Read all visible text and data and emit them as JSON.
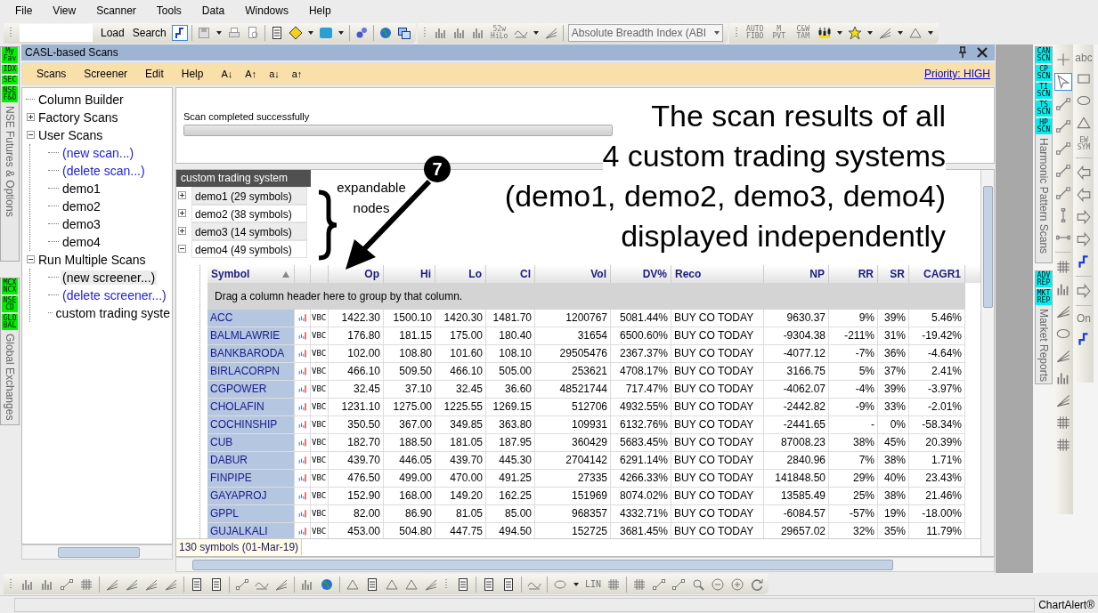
{
  "menu": [
    "File",
    "View",
    "Scanner",
    "Tools",
    "Data",
    "Windows",
    "Help"
  ],
  "toolbar": {
    "buttons": [
      "Load",
      "Search"
    ],
    "chart_labels": [
      "52w HiLo"
    ],
    "indicator_combo": "Absolute Breadth Index (ABI",
    "tool_labels": [
      "AUTO FIBO",
      "M PVT",
      "C&W TAM"
    ]
  },
  "left_tabs": [
    {
      "badges": [
        "My Fav",
        "IDX",
        "SEC",
        "NSE F&O"
      ],
      "label": "NSE Futures & Options"
    },
    {
      "badges": [
        "MCX NCX",
        "NSE CD",
        "GLOBAL"
      ],
      "label": "Global Exchanges"
    }
  ],
  "panel": {
    "title": "CASL-based Scans",
    "menu": [
      "Scans",
      "Screener",
      "Edit",
      "Help"
    ],
    "sort_buttons": [
      "A↓",
      "A↑",
      "a↓",
      "a↑"
    ],
    "priority_link": "Priority: HIGH"
  },
  "tree": [
    {
      "label": "Column Builder",
      "kind": "item",
      "selected": false
    },
    {
      "label": "Factory Scans",
      "kind": "folder",
      "expanded": false,
      "selected": false
    },
    {
      "label": "User Scans",
      "kind": "folder",
      "expanded": true,
      "selected": false,
      "children": [
        {
          "label": "(new scan...)",
          "kind": "action",
          "selected": false
        },
        {
          "label": "(delete scan...)",
          "kind": "action",
          "selected": false
        },
        {
          "label": "demo1",
          "kind": "item",
          "selected": false
        },
        {
          "label": "demo2",
          "kind": "item",
          "selected": false
        },
        {
          "label": "demo3",
          "kind": "item",
          "selected": false
        },
        {
          "label": "demo4",
          "kind": "item",
          "selected": false
        }
      ]
    },
    {
      "label": "Run Multiple Scans",
      "kind": "folder",
      "expanded": true,
      "selected": false,
      "children": [
        {
          "label": "(new screener...)",
          "kind": "action",
          "selected": true
        },
        {
          "label": "(delete screener...)",
          "kind": "action",
          "selected": false
        },
        {
          "label": "custom trading syste",
          "kind": "item",
          "selected": false
        }
      ]
    }
  ],
  "status": {
    "message": "Scan completed successfully",
    "level": 1
  },
  "results": {
    "title": "custom trading system",
    "groups": [
      {
        "label": "demo1 (29 symbols)",
        "expanded": false
      },
      {
        "label": "demo2 (38 symbols)",
        "expanded": false
      },
      {
        "label": "demo3 (14 symbols)",
        "expanded": false
      },
      {
        "label": "demo4 (49 symbols)",
        "expanded": true
      }
    ],
    "columns": [
      {
        "label": "Symbol",
        "kind": "symbol",
        "sorted_ascending": true
      },
      {
        "kind": "chart"
      },
      {
        "kind": "tag"
      },
      {
        "label": "Op",
        "kind": "number"
      },
      {
        "label": "Hi",
        "kind": "number"
      },
      {
        "label": "Lo",
        "kind": "number"
      },
      {
        "label": "Cl",
        "kind": "number"
      },
      {
        "label": "Vol",
        "kind": "number"
      },
      {
        "label": "DV%",
        "kind": "number"
      },
      {
        "label": "Reco",
        "kind": "text"
      },
      {
        "label": "NP",
        "kind": "number"
      },
      {
        "label": "RR",
        "kind": "number"
      },
      {
        "label": "SR",
        "kind": "number"
      },
      {
        "label": "CAGR1",
        "kind": "number"
      }
    ],
    "group_hint": "Drag a column header here to group by that column.",
    "rows": [
      {
        "cells": [
          "ACC",
          "",
          "VBC",
          "1422.30",
          "1500.10",
          "1420.30",
          "1481.70",
          "1200767",
          "5081.44%",
          "BUY CO TODAY",
          "9630.37",
          "9%",
          "39%",
          "5.46%"
        ]
      },
      {
        "cells": [
          "BALMLAWRIE",
          "",
          "VBC",
          "176.80",
          "181.15",
          "175.00",
          "180.40",
          "31654",
          "6500.60%",
          "BUY CO TODAY",
          "-9304.38",
          "-211%",
          "31%",
          "-19.42%"
        ]
      },
      {
        "cells": [
          "BANKBARODA",
          "",
          "VBC",
          "102.00",
          "108.80",
          "101.60",
          "108.10",
          "29505476",
          "2367.37%",
          "BUY CO TODAY",
          "-4077.12",
          "-7%",
          "36%",
          "-4.64%"
        ]
      },
      {
        "cells": [
          "BIRLACORPN",
          "",
          "VBC",
          "466.10",
          "509.50",
          "466.10",
          "505.00",
          "253621",
          "4708.17%",
          "BUY CO TODAY",
          "3166.75",
          "5%",
          "37%",
          "2.41%"
        ]
      },
      {
        "cells": [
          "CGPOWER",
          "",
          "VBC",
          "32.45",
          "37.10",
          "32.45",
          "36.60",
          "48521744",
          "717.47%",
          "BUY CO TODAY",
          "-4062.07",
          "-4%",
          "39%",
          "-3.97%"
        ]
      },
      {
        "cells": [
          "CHOLAFIN",
          "",
          "VBC",
          "1231.10",
          "1275.00",
          "1225.55",
          "1269.15",
          "512706",
          "4932.55%",
          "BUY CO TODAY",
          "-2442.82",
          "-9%",
          "33%",
          "-2.01%"
        ]
      },
      {
        "cells": [
          "COCHINSHIP",
          "",
          "VBC",
          "350.50",
          "367.00",
          "349.85",
          "363.80",
          "109931",
          "6132.76%",
          "BUY CO TODAY",
          "-2441.65",
          "-",
          "0%",
          "-58.34%"
        ]
      },
      {
        "cells": [
          "CUB",
          "",
          "VBC",
          "182.70",
          "188.50",
          "181.05",
          "187.95",
          "360429",
          "5683.45%",
          "BUY CO TODAY",
          "87008.23",
          "38%",
          "45%",
          "20.39%"
        ]
      },
      {
        "cells": [
          "DABUR",
          "",
          "VBC",
          "439.70",
          "446.05",
          "439.70",
          "445.30",
          "2704142",
          "6291.14%",
          "BUY CO TODAY",
          "2840.96",
          "7%",
          "38%",
          "1.71%"
        ]
      },
      {
        "cells": [
          "FINPIPE",
          "",
          "VBC",
          "476.50",
          "499.00",
          "470.00",
          "491.25",
          "27335",
          "4266.33%",
          "BUY CO TODAY",
          "141848.50",
          "29%",
          "40%",
          "23.43%"
        ]
      },
      {
        "cells": [
          "GAYAPROJ",
          "",
          "VBC",
          "152.90",
          "168.00",
          "149.20",
          "162.25",
          "151969",
          "8074.02%",
          "BUY CO TODAY",
          "13585.49",
          "25%",
          "38%",
          "21.46%"
        ]
      },
      {
        "cells": [
          "GPPL",
          "",
          "VBC",
          "82.00",
          "86.90",
          "81.05",
          "85.00",
          "968357",
          "4332.71%",
          "BUY CO TODAY",
          "-6084.57",
          "-57%",
          "19%",
          "-18.00%"
        ]
      },
      {
        "cells": [
          "GUJALKALI",
          "",
          "VBC",
          "453.00",
          "504.80",
          "447.75",
          "494.50",
          "152725",
          "3681.45%",
          "BUY CO TODAY",
          "29657.02",
          "32%",
          "35%",
          "11.79%"
        ]
      }
    ],
    "footer": "130 symbols (01-Mar-19)"
  },
  "annotation": {
    "number": "7",
    "callout": "expandable nodes",
    "lines": [
      "The scan results of all",
      "4 custom trading systems",
      "(demo1, demo2, demo3, demo4)",
      "displayed independently"
    ]
  },
  "right_tabs": [
    {
      "badges": [
        "CAN SCN",
        "CP SCN",
        "TI SCN",
        "TS SCN",
        "HP SCN"
      ],
      "label": "Harmonic Pattern Scans"
    },
    {
      "badges": [
        "ADV REP",
        "MKT REP"
      ],
      "label": "Market Reports"
    }
  ],
  "drawing_tools": {
    "labels": [
      "abc",
      "EW SYM",
      "On"
    ]
  },
  "bottom_toolbar": {
    "labels": [
      "LIN"
    ]
  },
  "status_bar": {
    "brand": "ChartAlert®"
  }
}
